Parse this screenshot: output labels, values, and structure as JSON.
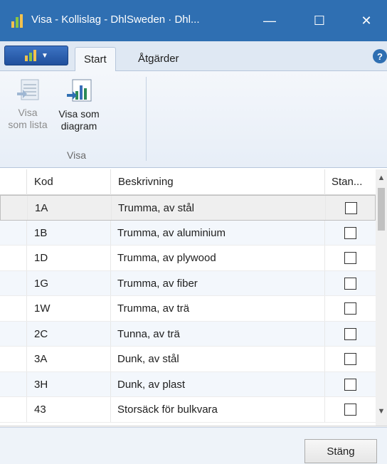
{
  "window": {
    "title": "Visa - Kollislag - DhlSweden · Dhl...",
    "minimize": "—",
    "maximize": "☐",
    "close": "✕"
  },
  "tabs": {
    "start": "Start",
    "atgarder": "Åtgärder",
    "help": "?"
  },
  "ribbon": {
    "visa_som_lista_line1": "Visa",
    "visa_som_lista_line2": "som lista",
    "visa_som_diagram_line1": "Visa som",
    "visa_som_diagram_line2": "diagram",
    "group_label": "Visa"
  },
  "grid": {
    "headers": {
      "kod": "Kod",
      "beskrivning": "Beskrivning",
      "standard": "Stan..."
    },
    "rows": [
      {
        "kod": "1A",
        "beskrivning": "Trumma, av stål"
      },
      {
        "kod": "1B",
        "beskrivning": "Trumma, av aluminium"
      },
      {
        "kod": "1D",
        "beskrivning": "Trumma, av plywood"
      },
      {
        "kod": "1G",
        "beskrivning": "Trumma, av fiber"
      },
      {
        "kod": "1W",
        "beskrivning": "Trumma, av trä"
      },
      {
        "kod": "2C",
        "beskrivning": "Tunna, av trä"
      },
      {
        "kod": "3A",
        "beskrivning": "Dunk, av stål"
      },
      {
        "kod": "3H",
        "beskrivning": "Dunk, av plast"
      },
      {
        "kod": "43",
        "beskrivning": "Storsäck för bulkvara"
      }
    ]
  },
  "footer": {
    "close_label": "Stäng"
  },
  "colors": {
    "titlebar": "#2f6fb2",
    "ribbon": "#e7eef7",
    "alt_row": "#f3f7fc"
  }
}
